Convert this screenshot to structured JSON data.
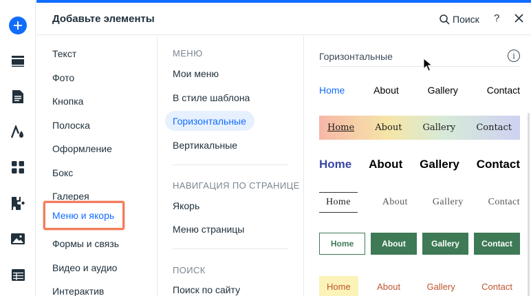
{
  "rail": {
    "items": [
      "add-icon",
      "layout-icon",
      "page-icon",
      "design-icon",
      "apps-icon",
      "puzzle-icon",
      "media-icon",
      "table-icon"
    ]
  },
  "header": {
    "title": "Добавьте элементы",
    "search_label": "Поиск",
    "help_label": "?"
  },
  "categories": [
    "Текст",
    "Фото",
    "Кнопка",
    "Полоска",
    "Оформление",
    "Бокс",
    "Галерея",
    "Меню и якорь",
    "Формы и связь",
    "Видео и аудио",
    "Интерактив"
  ],
  "selected_category": "Меню и якорь",
  "subcategories": {
    "section_menu": "МЕНЮ",
    "menu_items": [
      "Мои меню",
      "В стиле шаблона",
      "Горизонтальные",
      "Вертикальные"
    ],
    "selected": "Горизонтальные",
    "section_nav": "НАВИГАЦИЯ ПО СТРАНИЦЕ",
    "nav_items": [
      "Якорь",
      "Меню страницы"
    ],
    "section_search": "ПОИСК",
    "search_items": [
      "Поиск по сайту"
    ]
  },
  "preview": {
    "title": "Горизонтальные",
    "info_label": "i",
    "menus": [
      [
        "Home",
        "About",
        "Gallery",
        "Contact"
      ],
      [
        "Home",
        "About",
        "Gallery",
        "Contact"
      ],
      [
        "Home",
        "About",
        "Gallery",
        "Contact"
      ],
      [
        "Home",
        "About",
        "Gallery",
        "Contact"
      ],
      [
        "Home",
        "About",
        "Gallery",
        "Contact"
      ],
      [
        "Home",
        "About",
        "Gallery",
        "Contact"
      ]
    ]
  },
  "colors": {
    "accent": "#116dff",
    "highlight_border": "#f27c5b",
    "green": "#3d7a55"
  }
}
